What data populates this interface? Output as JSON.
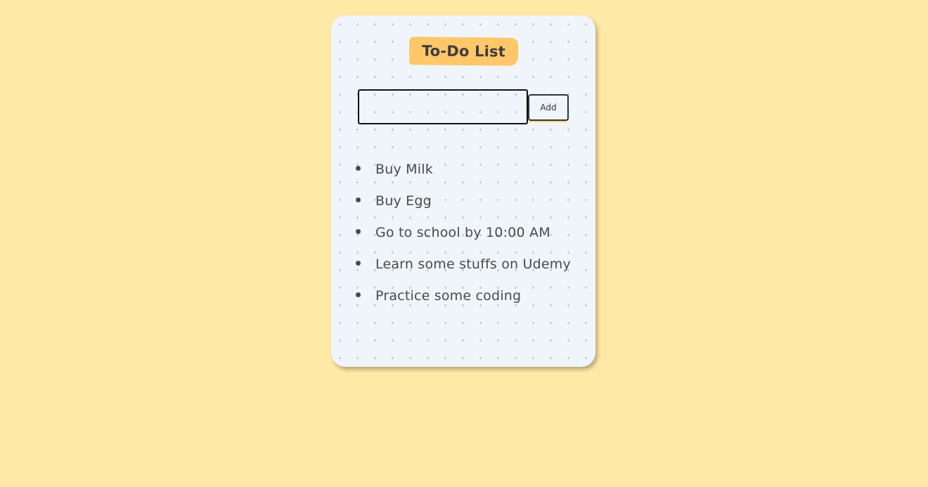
{
  "app": {
    "title": "To-Do List"
  },
  "input": {
    "value": "",
    "placeholder": ""
  },
  "actions": {
    "add_label": "Add"
  },
  "items": [
    {
      "text": "Buy Milk"
    },
    {
      "text": "Buy Egg"
    },
    {
      "text": "Go to school by 10:00 AM"
    },
    {
      "text": "Learn some stuffs on Udemy"
    },
    {
      "text": "Practice some coding"
    }
  ],
  "colors": {
    "page_background": "#ffe9a6",
    "card_background": "#eff5fa",
    "heading_background": "#ffc76a",
    "text": "#4a4a4a"
  }
}
